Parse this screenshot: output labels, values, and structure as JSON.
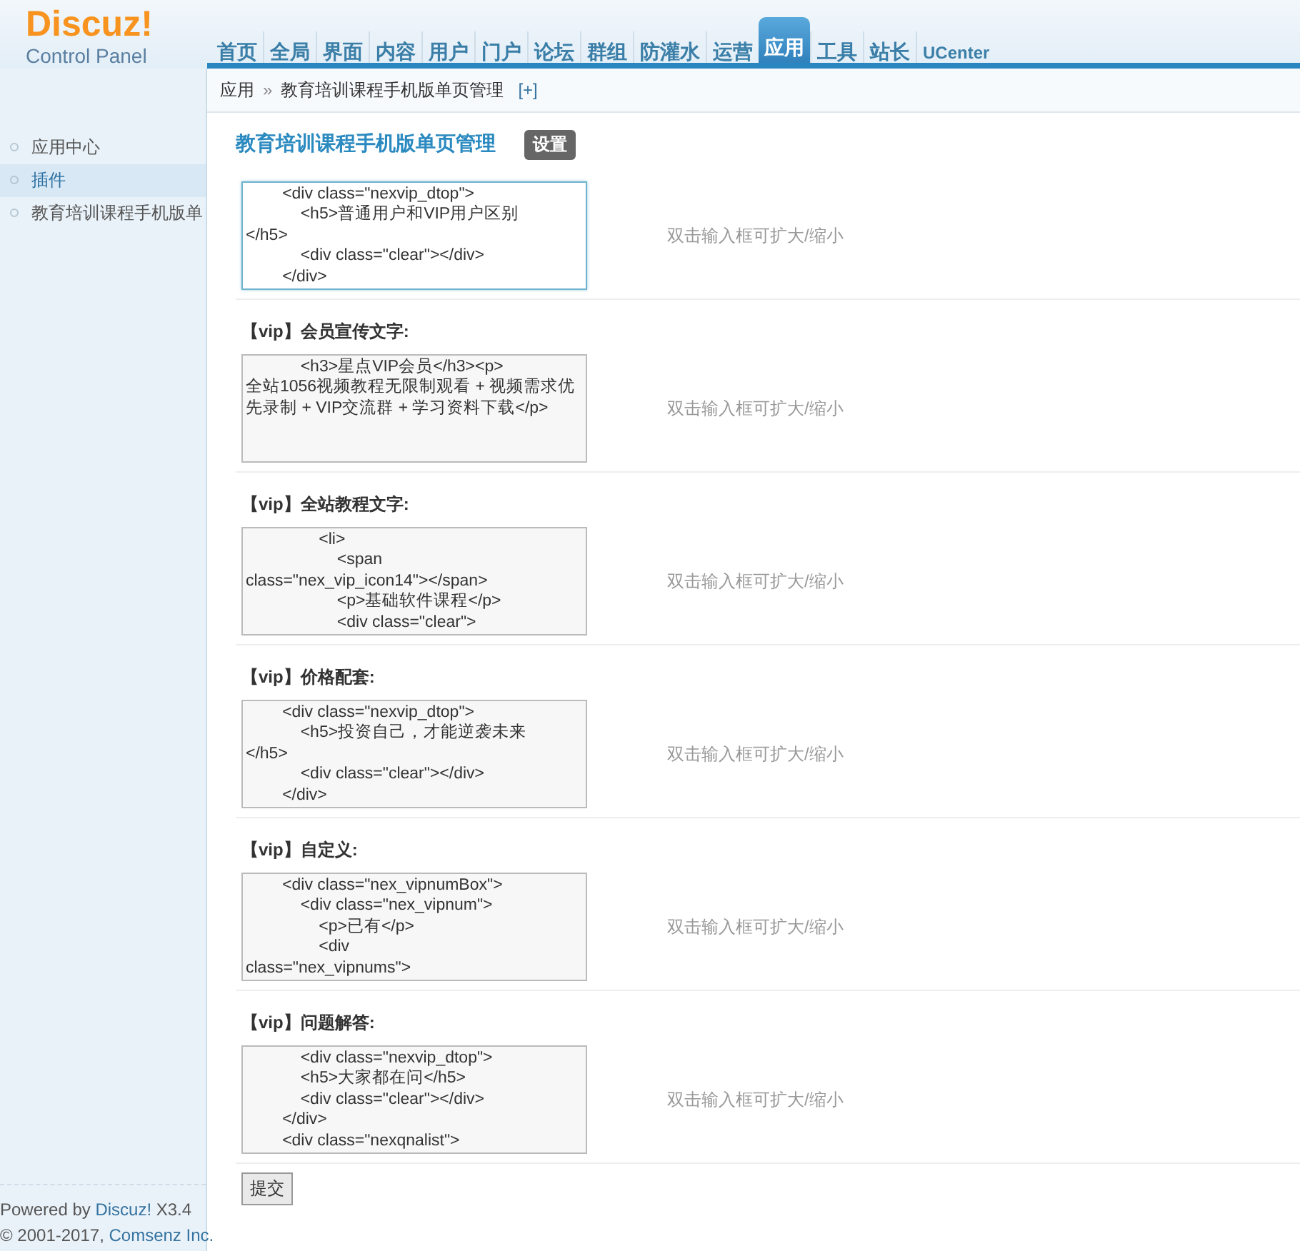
{
  "logo": {
    "name": "Discuz!",
    "subtitle": "Control Panel"
  },
  "nav": [
    {
      "label": "首页",
      "selected": false
    },
    {
      "label": "全局",
      "selected": false
    },
    {
      "label": "界面",
      "selected": false
    },
    {
      "label": "内容",
      "selected": false
    },
    {
      "label": "用户",
      "selected": false
    },
    {
      "label": "门户",
      "selected": false
    },
    {
      "label": "论坛",
      "selected": false
    },
    {
      "label": "群组",
      "selected": false
    },
    {
      "label": "防灌水",
      "selected": false
    },
    {
      "label": "运营",
      "selected": false
    },
    {
      "label": "应用",
      "selected": true
    },
    {
      "label": "工具",
      "selected": false
    },
    {
      "label": "站长",
      "selected": false
    },
    {
      "label": "UCenter",
      "selected": false
    }
  ],
  "sidebar": {
    "items": [
      {
        "label": "应用中心",
        "selected": false
      },
      {
        "label": "插件",
        "selected": true
      },
      {
        "label": "教育培训课程手机版单",
        "selected": false
      }
    ],
    "footer": [
      {
        "prefix": "Powered by ",
        "link": "Discuz!",
        "suffix": " X3.4"
      },
      {
        "prefix": "© 2001-2017, ",
        "link": "Comsenz Inc."
      }
    ]
  },
  "breadcrumb": {
    "parent": "应用",
    "separator": "»",
    "current": "教育培训课程手机版单页管理",
    "toggle": "[+]"
  },
  "page": {
    "title": "教育培训课程手机版单页管理",
    "badge": "设置"
  },
  "rows": [
    {
      "value": "        <div class=\"nexvip_dtop\">\n            <h5>普通用户和VIP用户区别\n</h5>\n            <div class=\"clear\"></div>\n        </div>",
      "hint": "双击输入框可扩大/缩小",
      "focused": true
    },
    {
      "label": "【vip】会员宣传文字:",
      "value": "            <h3>星点VIP会员</h3><p>\n全站1056视频教程无限制观看 + 视频需求优先录制 + VIP交流群 + 学习资料下载</p>",
      "hint": "双击输入框可扩大/缩小",
      "focused": false
    },
    {
      "label": "【vip】全站教程文字:",
      "value": "                <li>\n                    <span\nclass=\"nex_vip_icon14\"></span>\n                    <p>基础软件课程</p>\n                    <div class=\"clear\">",
      "hint": "双击输入框可扩大/缩小",
      "focused": false
    },
    {
      "label": "【vip】价格配套:",
      "value": "        <div class=\"nexvip_dtop\">\n            <h5>投资自己，才能逆袭未来\n</h5>\n            <div class=\"clear\"></div>\n        </div>",
      "hint": "双击输入框可扩大/缩小",
      "focused": false
    },
    {
      "label": "【vip】自定义:",
      "value": "        <div class=\"nex_vipnumBox\">\n            <div class=\"nex_vipnum\">\n                <p>已有</p>\n                <div\nclass=\"nex_vipnums\">",
      "hint": "双击输入框可扩大/缩小",
      "focused": false
    },
    {
      "label": "【vip】问题解答:",
      "value": "            <div class=\"nexvip_dtop\">\n            <h5>大家都在问</h5>\n            <div class=\"clear\"></div>\n        </div>\n        <div class=\"nexqnalist\">",
      "hint": "双击输入框可扩大/缩小",
      "focused": false
    }
  ],
  "submit": "提交"
}
